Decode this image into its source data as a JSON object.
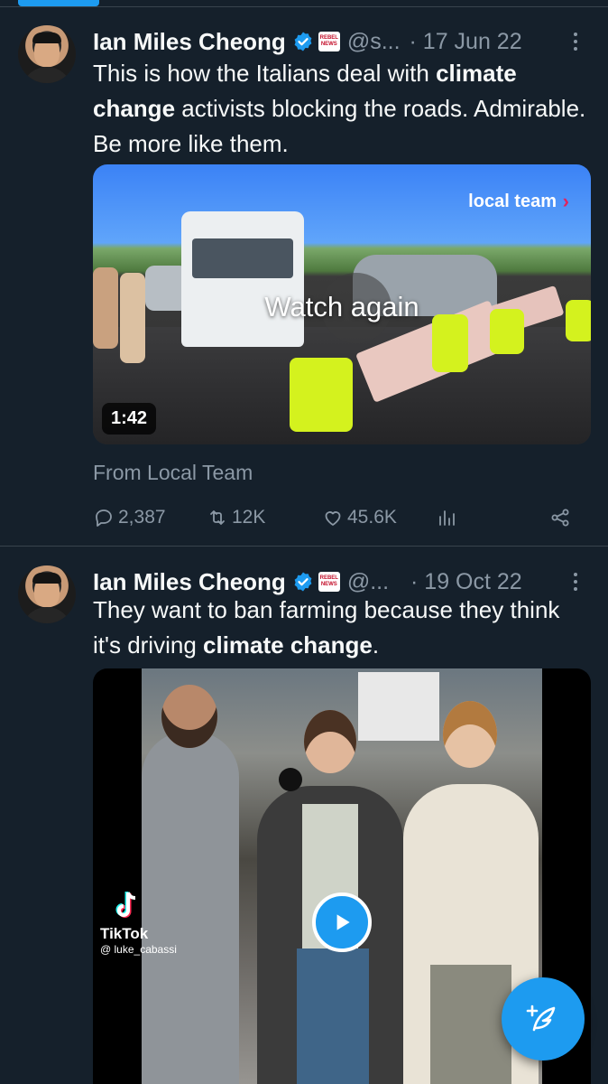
{
  "colors": {
    "background": "#15202b",
    "accent": "#1d9bf0",
    "text_primary": "#f7f9f9",
    "text_secondary": "#8b98a5",
    "divider": "#38444d"
  },
  "tweets": [
    {
      "author_name": "Ian Miles Cheong",
      "handle": "@s...",
      "date": "· 17 Jun 22",
      "text_parts": [
        "This is how the Italians deal with ",
        "climate change",
        " activists blocking the roads. Admirable. Be more like them."
      ],
      "media": {
        "watermark": "local team",
        "overlay_label": "Watch again",
        "duration": "1:42"
      },
      "source": "From Local Team",
      "stats": {
        "replies": "2,387",
        "retweets": "12K",
        "likes": "45.6K"
      }
    },
    {
      "author_name": "Ian Miles Cheong",
      "handle": "@...",
      "date": "· 19 Oct 22",
      "text_parts": [
        "They want to ban farming because they think it's driving ",
        "climate change",
        "."
      ],
      "media": {
        "platform_label": "TikTok",
        "platform_user": "@ luke_cabassi"
      }
    }
  ],
  "badge_text": [
    "REBEL",
    "NEWS"
  ],
  "icons": {
    "verified": "verified-badge-icon",
    "more": "more-options-icon",
    "reply": "reply-icon",
    "retweet": "retweet-icon",
    "like": "heart-icon",
    "views": "views-icon",
    "share": "share-icon",
    "play": "play-icon",
    "compose": "compose-tweet-icon"
  }
}
